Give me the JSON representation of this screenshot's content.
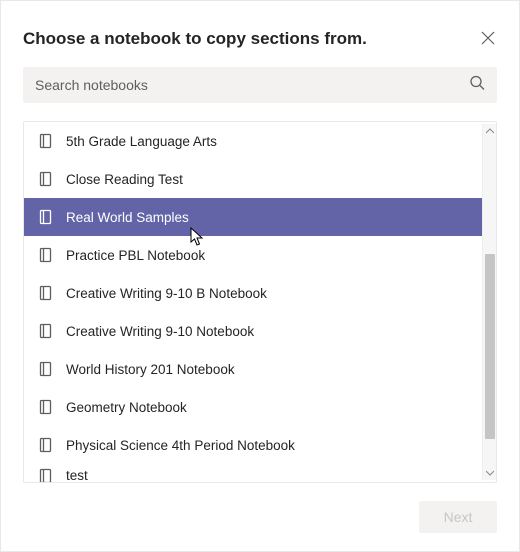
{
  "header": {
    "title": "Choose a notebook to copy sections from."
  },
  "search": {
    "placeholder": "Search notebooks"
  },
  "notebooks": [
    {
      "label": "5th Grade Language Arts",
      "selected": false
    },
    {
      "label": "Close Reading Test",
      "selected": false
    },
    {
      "label": "Real World Samples",
      "selected": true
    },
    {
      "label": "Practice PBL Notebook",
      "selected": false
    },
    {
      "label": "Creative Writing 9-10 B Notebook",
      "selected": false
    },
    {
      "label": "Creative Writing 9-10 Notebook",
      "selected": false
    },
    {
      "label": "World History 201 Notebook",
      "selected": false
    },
    {
      "label": "Geometry Notebook",
      "selected": false
    },
    {
      "label": "Physical Science 4th Period Notebook",
      "selected": false
    }
  ],
  "partial_item": {
    "label": "test"
  },
  "footer": {
    "next_label": "Next"
  }
}
